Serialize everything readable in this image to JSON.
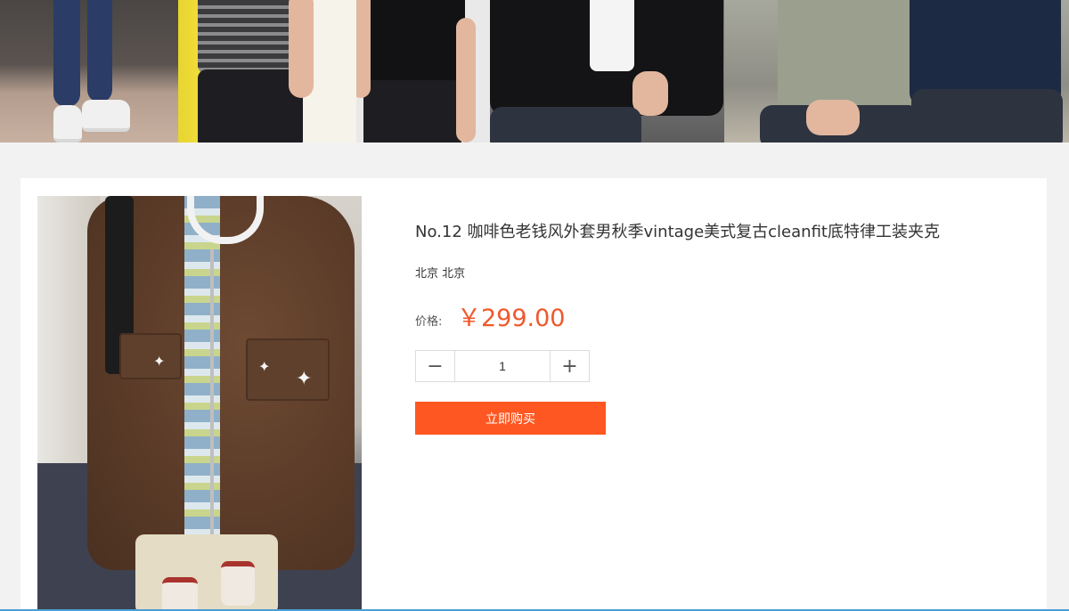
{
  "product": {
    "title": "No.12 咖啡色老钱风外套男秋季vintage美式复古cleanfit底特律工装夹克",
    "location": "北京 北京",
    "price_label": "价格:",
    "price": "￥299.00",
    "quantity": "1",
    "decrement_icon": "minus-icon",
    "increment_icon": "plus-icon",
    "decrement_glyph": "−",
    "increment_glyph": "+",
    "buy_label": "立即购买"
  },
  "colors": {
    "accent": "#ff5722",
    "price": "#f0582b",
    "page_bg": "#f2f2f2",
    "card_bg": "#ffffff"
  }
}
